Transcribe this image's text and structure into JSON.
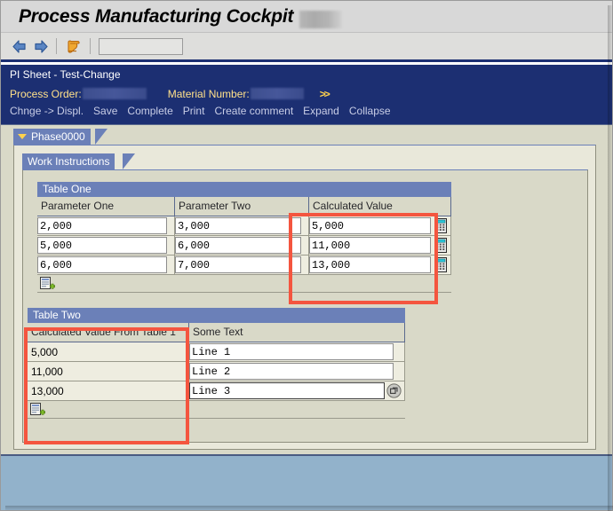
{
  "window": {
    "title": "Process Manufacturing Cockpit",
    "title_redacted": true
  },
  "toolbar": {
    "back_icon": "arrow-left-icon",
    "forward_icon": "arrow-right-icon",
    "scroll_icon": "scroll-document-icon",
    "address_value": "",
    "address_placeholder": ""
  },
  "header": {
    "pi_sheet_title": "PI Sheet - Test-Change",
    "process_order_label": "Process Order:",
    "process_order_value": "",
    "material_number_label": "Material Number:",
    "material_number_value": "",
    "more_chevron": ">>",
    "links": [
      {
        "label": "Chnge -> Displ."
      },
      {
        "label": "Save"
      },
      {
        "label": "Complete"
      },
      {
        "label": "Print"
      },
      {
        "label": "Create comment"
      },
      {
        "label": "Expand"
      },
      {
        "label": "Collapse"
      }
    ]
  },
  "phase": {
    "tab_label": "Phase0000",
    "expander_icon": "triangle-down-icon"
  },
  "work_instructions": {
    "tab_label": "Work Instructions"
  },
  "table_one": {
    "caption": "Table One",
    "columns": [
      "Parameter One",
      "Parameter Two",
      "Calculated Value"
    ],
    "rows": [
      {
        "parameter_one": "2,000",
        "parameter_two": "3,000",
        "calculated_value": "5,000"
      },
      {
        "parameter_one": "5,000",
        "parameter_two": "6,000",
        "calculated_value": "11,000"
      },
      {
        "parameter_one": "6,000",
        "parameter_two": "7,000",
        "calculated_value": "13,000"
      }
    ],
    "row_action_icon": "insert-row-icon",
    "calc_icon": "calculator-icon"
  },
  "table_two": {
    "caption": "Table Two",
    "columns": [
      "Calculated Value From Table 1",
      "Some Text"
    ],
    "rows": [
      {
        "calculated_value": "5,000",
        "some_text": "Line 1"
      },
      {
        "calculated_value": "11,000",
        "some_text": "Line 2"
      },
      {
        "calculated_value": "13,000",
        "some_text": "Line 3"
      }
    ],
    "focused_row_index": 2,
    "row_action_icon": "insert-row-icon",
    "popout_icon": "popout-editor-icon"
  },
  "annotations": [
    {
      "name": "highlight-calculated-value-column"
    },
    {
      "name": "highlight-calculated-value-from-table-1-column"
    }
  ],
  "colors": {
    "header_blue": "#1c2f72",
    "tab_blue": "#6b80b8",
    "canvas_beige": "#d9d9c8",
    "panel_beige": "#e9e8da",
    "row_beige": "#eeede0",
    "annotation_red": "#f4553f",
    "footer_blue": "#92b2cb",
    "link_color": "#c8cde6",
    "field_label_yellow": "#ffe08a"
  }
}
